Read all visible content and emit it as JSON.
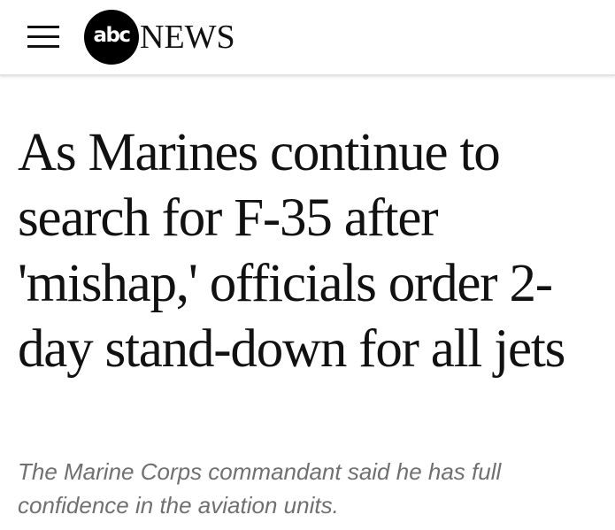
{
  "header": {
    "menu_icon": "hamburger-menu-icon",
    "logo": {
      "circle_text": "abc",
      "word_text": "NEWS"
    }
  },
  "article": {
    "headline": "As Marines continue to search for F-35 after 'mishap,' officials order 2-day stand-down for all jets",
    "subheadline": "The Marine Corps commandant said he has full confidence in the aviation units."
  },
  "colors": {
    "text": "#111111",
    "subtext": "#707070",
    "logo_bg": "#000000",
    "header_border": "#e2e2e2"
  }
}
